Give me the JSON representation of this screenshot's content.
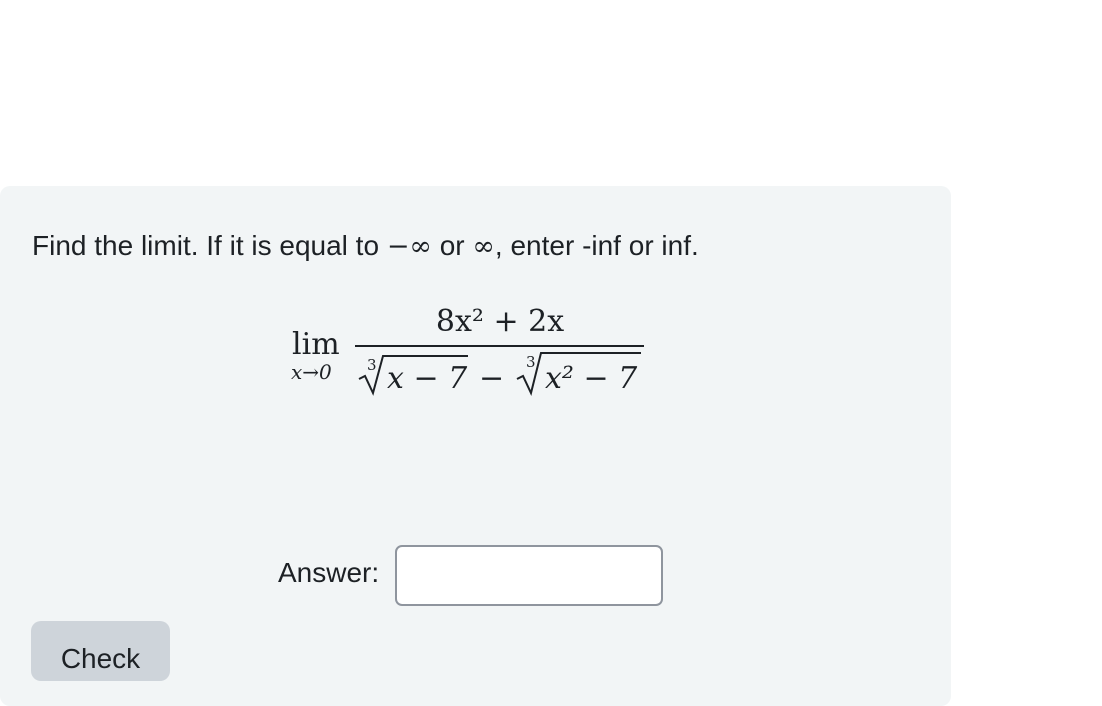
{
  "question": {
    "prompt_part1": "Find the limit. If it is equal to ",
    "neg_infinity": "−∞",
    "prompt_part2": " or ",
    "infinity": "∞",
    "prompt_part3": ", enter -inf or inf.",
    "formula": {
      "lim_label": "lim",
      "lim_subscript": "x→0",
      "numerator": "8x² + 2x",
      "denominator_root1_index": "3",
      "denominator_root1_radicand": "x − 7",
      "denominator_operator": "−",
      "denominator_root2_index": "3",
      "denominator_root2_radicand": "x² − 7"
    }
  },
  "answer": {
    "label": "Answer:",
    "value": "",
    "placeholder": ""
  },
  "actions": {
    "check_label": "Check"
  },
  "colors": {
    "card_background": "#f2f5f6",
    "input_border": "#8f959e",
    "button_background": "#ced4da",
    "text": "#1d2125"
  }
}
